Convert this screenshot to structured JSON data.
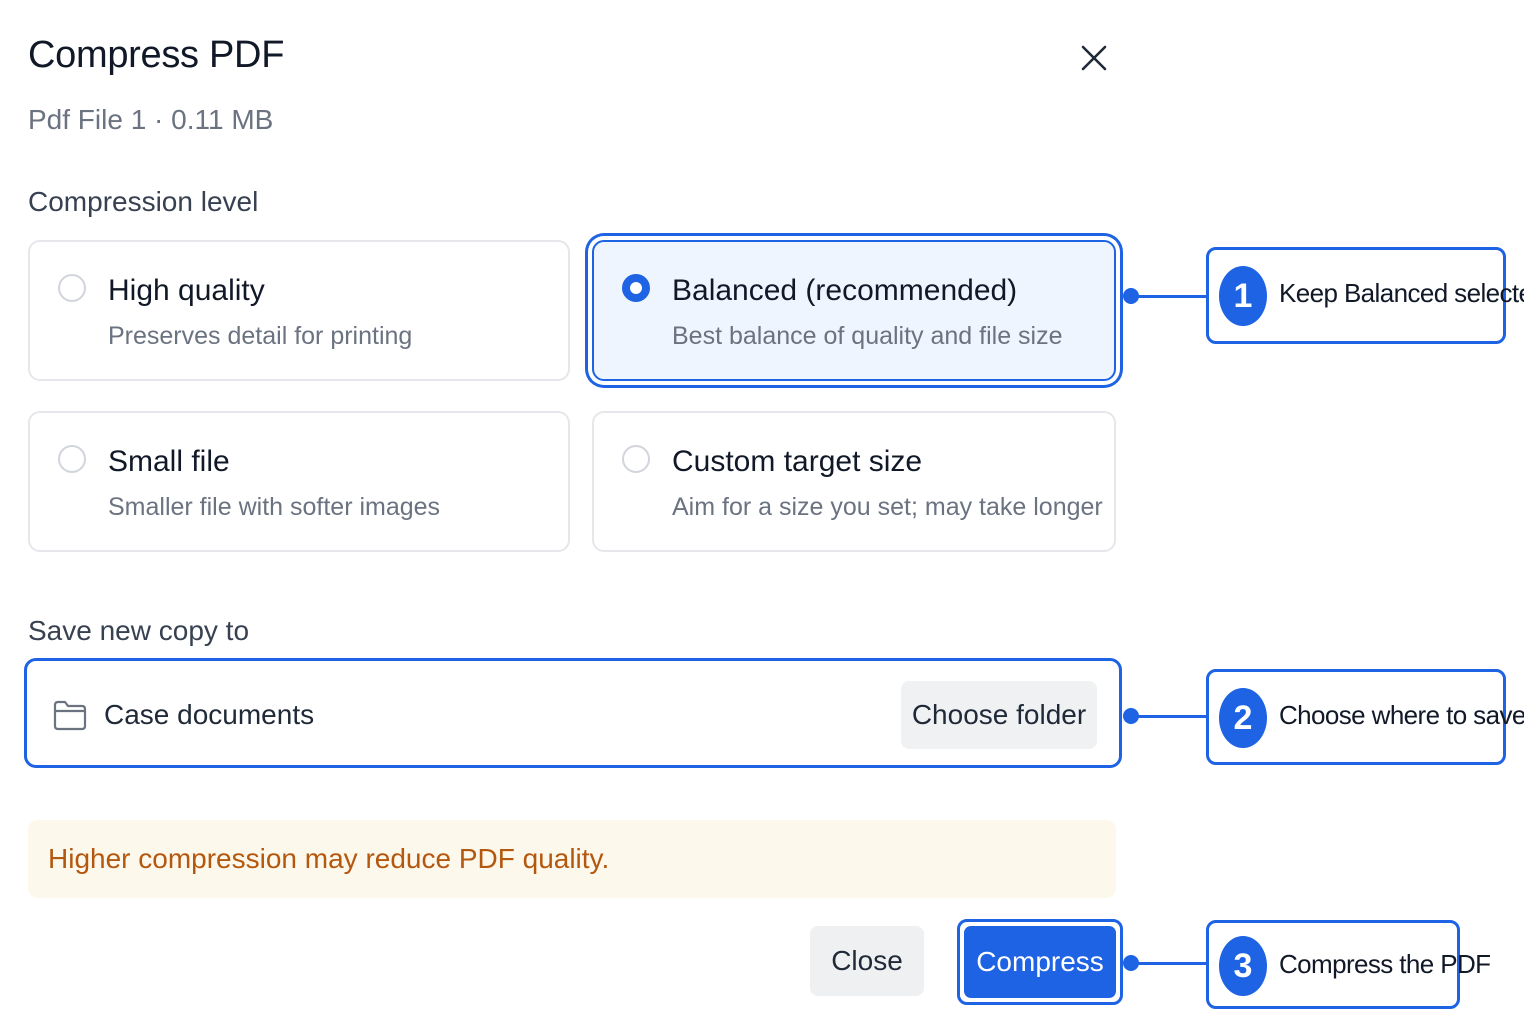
{
  "dialog": {
    "title": "Compress PDF",
    "subtitle": "Pdf File 1 · 0.11 MB",
    "close_icon": "close-icon"
  },
  "compression": {
    "label": "Compression level",
    "selected": "Balanced (recommended)",
    "options": [
      {
        "title": "High quality",
        "description": "Preserves detail for printing",
        "selected": false
      },
      {
        "title": "Balanced (recommended)",
        "description": "Best balance of quality and file size",
        "selected": true
      },
      {
        "title": "Small file",
        "description": "Smaller file with softer images",
        "selected": false
      },
      {
        "title": "Custom target size",
        "description": "Aim for a size you set; may take longer",
        "selected": false
      }
    ]
  },
  "save": {
    "label": "Save new copy to",
    "folder_icon": "folder-icon",
    "folder": "Case documents",
    "choose_label": "Choose folder"
  },
  "warning": {
    "text": "Higher compression may reduce PDF quality."
  },
  "footer": {
    "close_label": "Close",
    "compress_label": "Compress"
  },
  "callouts": [
    {
      "number": "1",
      "text": "Keep Balanced selected"
    },
    {
      "number": "2",
      "text": "Choose where to save it"
    },
    {
      "number": "3",
      "text": "Compress the PDF"
    }
  ],
  "colors": {
    "accent": "#1d63e3",
    "selected_bg": "#eef5ff",
    "warning_bg": "#fdf8ec",
    "warning_text": "#b4580f"
  }
}
